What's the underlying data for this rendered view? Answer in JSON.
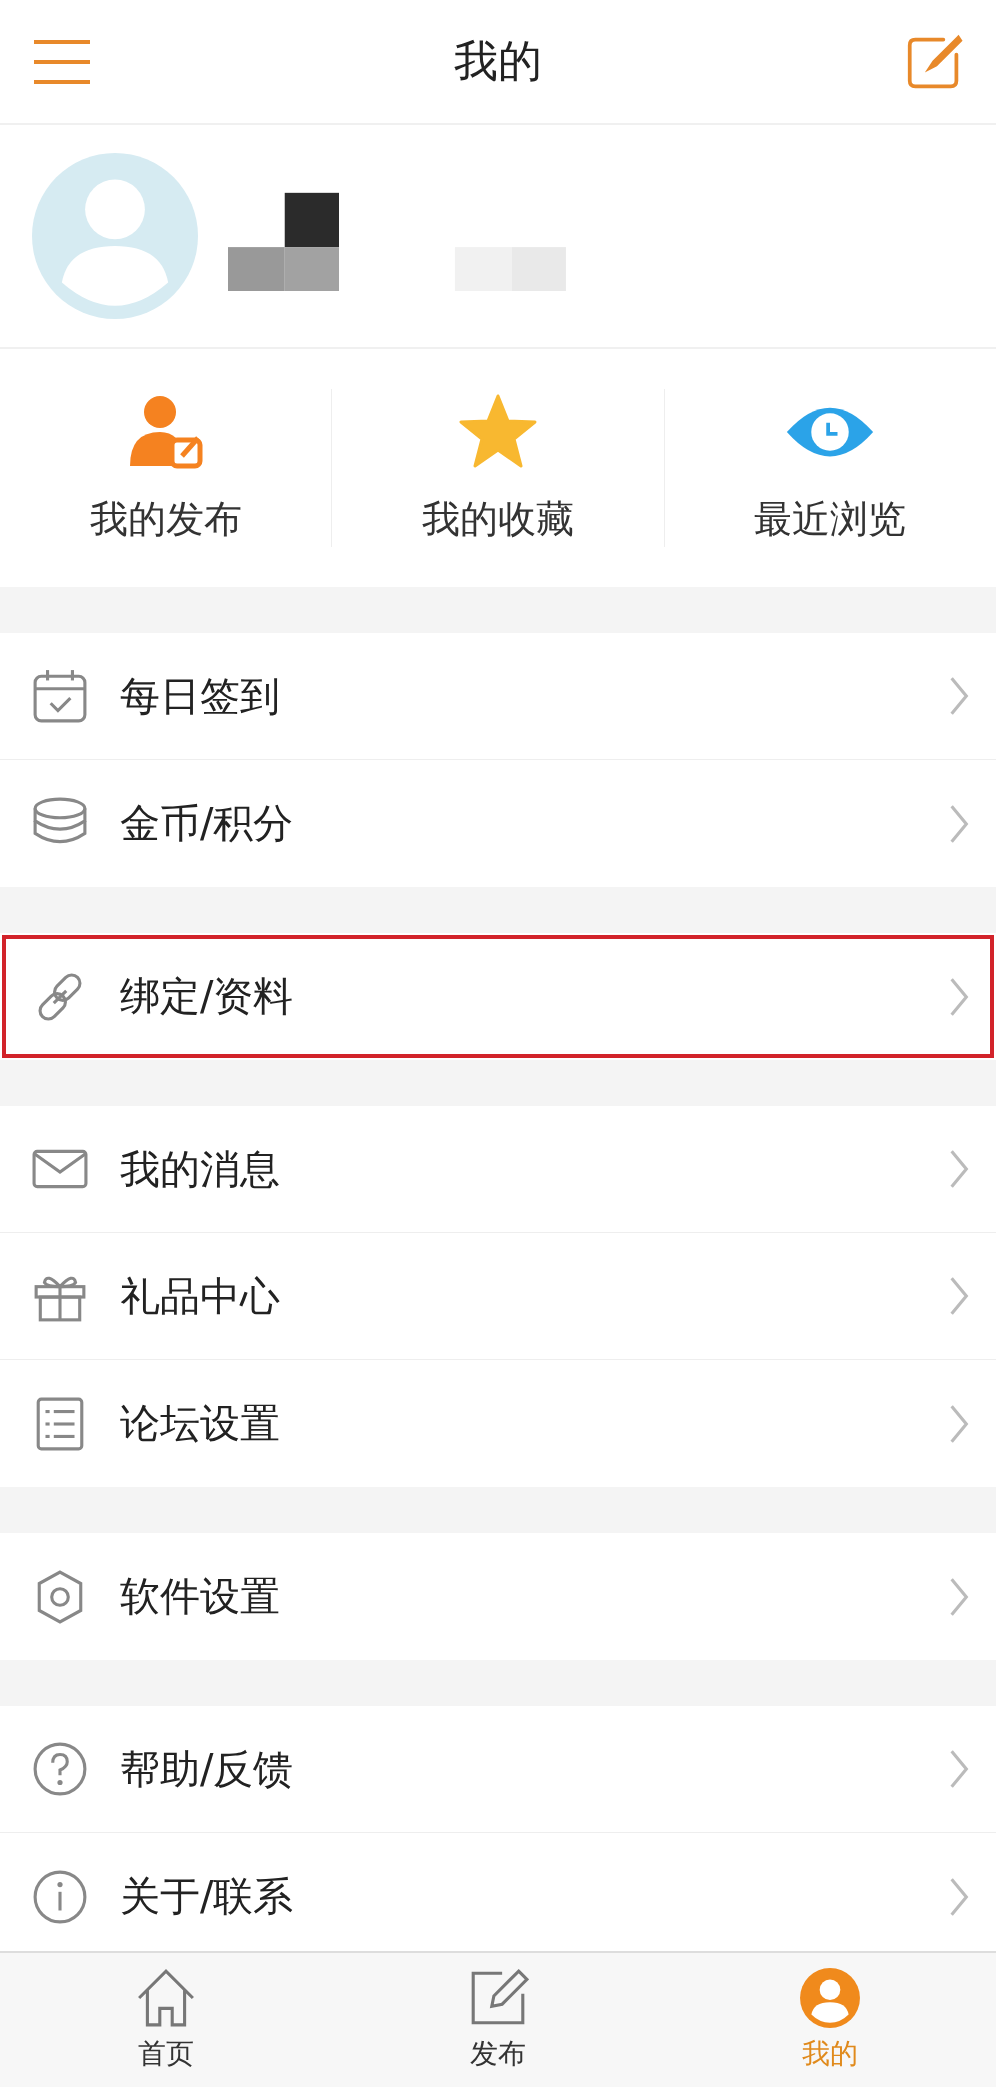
{
  "header": {
    "title": "我的"
  },
  "quick_actions": [
    {
      "kind": "post",
      "label": "我的发布"
    },
    {
      "kind": "favorite",
      "label": "我的收藏"
    },
    {
      "kind": "history",
      "label": "最近浏览"
    }
  ],
  "menu_groups": [
    [
      {
        "kind": "checkin",
        "label": "每日签到",
        "highlighted": false
      },
      {
        "kind": "coins",
        "label": "金币/积分",
        "highlighted": false
      }
    ],
    [
      {
        "kind": "link",
        "label": "绑定/资料",
        "highlighted": true
      }
    ],
    [
      {
        "kind": "message",
        "label": "我的消息",
        "highlighted": false
      },
      {
        "kind": "gift",
        "label": "礼品中心",
        "highlighted": false
      },
      {
        "kind": "list",
        "label": "论坛设置",
        "highlighted": false
      }
    ],
    [
      {
        "kind": "settings",
        "label": "软件设置",
        "highlighted": false
      }
    ],
    [
      {
        "kind": "help",
        "label": "帮助/反馈",
        "highlighted": false
      },
      {
        "kind": "info",
        "label": "关于/联系",
        "highlighted": false
      }
    ]
  ],
  "tab_bar": [
    {
      "kind": "home",
      "label": "首页",
      "selected": false
    },
    {
      "kind": "post",
      "label": "发布",
      "selected": false
    },
    {
      "kind": "me",
      "label": "我的",
      "selected": true
    }
  ]
}
